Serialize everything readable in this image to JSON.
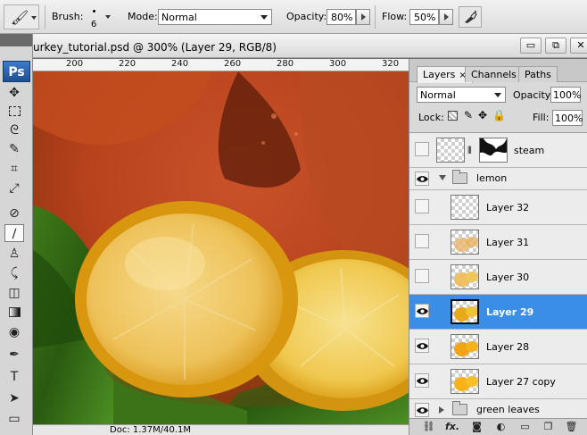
{
  "options_bar": {
    "brush_label": "Brush:",
    "brush_size": "6",
    "mode_label": "Mode:",
    "mode_value": "Normal",
    "opacity_label": "Opacity:",
    "opacity_value": "80%",
    "flow_label": "Flow:",
    "flow_value": "50%"
  },
  "tools": {
    "logo": "Ps",
    "items": [
      "move-tool",
      "marquee-tool",
      "lasso-tool",
      "quick-selection-tool",
      "crop-tool",
      "eyedropper-tool",
      "healing-brush-tool",
      "brush-tool",
      "clone-stamp-tool",
      "history-brush-tool",
      "eraser-tool",
      "gradient-tool",
      "dodge-tool",
      "pen-tool",
      "type-tool",
      "path-selection-tool",
      "shape-tool"
    ],
    "active": "brush-tool"
  },
  "document": {
    "title": "urkey_tutorial.psd @ 300% (Layer 29, RGB/8)",
    "ruler_labels": [
      "200",
      "220",
      "240",
      "260",
      "280",
      "300",
      "320"
    ],
    "status_doc": "Doc: 1.37M/40.1M"
  },
  "window_controls": {
    "minimize": "▭",
    "restore": "⧉",
    "close": "✕"
  },
  "layers_panel": {
    "tabs": [
      {
        "label": "Layers",
        "active": true,
        "close": "×"
      },
      {
        "label": "Channels",
        "active": false
      },
      {
        "label": "Paths",
        "active": false
      }
    ],
    "blend_mode": "Normal",
    "opacity_label": "Opacity:",
    "opacity_value": "100%",
    "lock_label": "Lock:",
    "fill_label": "Fill:",
    "fill_value": "100%",
    "layers": [
      {
        "name": "steam",
        "visible": false,
        "type": "masked"
      },
      {
        "name": "lemon",
        "visible": true,
        "type": "group-open"
      },
      {
        "name": "Layer 32",
        "visible": false,
        "type": "layer"
      },
      {
        "name": "Layer 31",
        "visible": false,
        "type": "layer"
      },
      {
        "name": "Layer 30",
        "visible": false,
        "type": "layer"
      },
      {
        "name": "Layer 29",
        "visible": true,
        "type": "layer",
        "selected": true
      },
      {
        "name": "Layer 28",
        "visible": true,
        "type": "layer"
      },
      {
        "name": "Layer 27 copy",
        "visible": true,
        "type": "layer"
      },
      {
        "name": "green leaves",
        "visible": true,
        "type": "group-closed"
      }
    ],
    "footer_icons": [
      "link-icon",
      "fx-icon",
      "mask-icon",
      "adjustment-icon",
      "folder-icon",
      "new-layer-icon",
      "trash-icon"
    ],
    "fx_label": "fx."
  },
  "colors": {
    "selection": "#3a8ee6",
    "ps_logo": "#2a63ad"
  }
}
